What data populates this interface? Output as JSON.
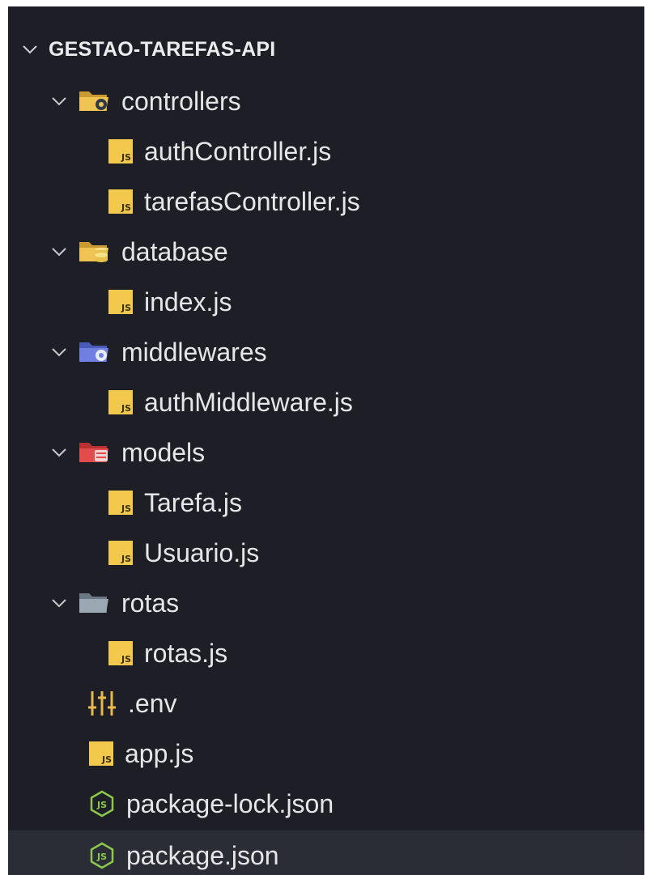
{
  "explorer": {
    "root_label": "GESTAO-TAREFAS-API",
    "js_badge": "JS",
    "items": [
      {
        "label": "controllers",
        "type": "folder",
        "icon": "folder-controllers-icon",
        "color": "#e8b84a"
      },
      {
        "label": "authController.js",
        "type": "js-file"
      },
      {
        "label": "tarefasController.js",
        "type": "js-file"
      },
      {
        "label": "database",
        "type": "folder",
        "icon": "folder-database-icon",
        "color": "#e8b84a"
      },
      {
        "label": "index.js",
        "type": "js-file"
      },
      {
        "label": "middlewares",
        "type": "folder",
        "icon": "folder-middleware-icon",
        "color": "#6b7bd6"
      },
      {
        "label": "authMiddleware.js",
        "type": "js-file"
      },
      {
        "label": "models",
        "type": "folder",
        "icon": "folder-models-icon",
        "color": "#e24c4c"
      },
      {
        "label": "Tarefa.js",
        "type": "js-file"
      },
      {
        "label": "Usuario.js",
        "type": "js-file"
      },
      {
        "label": "rotas",
        "type": "folder",
        "icon": "folder-icon",
        "color": "#8a9aa8"
      },
      {
        "label": "rotas.js",
        "type": "js-file"
      },
      {
        "label": ".env",
        "type": "env-file",
        "icon": "env-settings-icon"
      },
      {
        "label": "app.js",
        "type": "js-file"
      },
      {
        "label": "package-lock.json",
        "type": "node-file",
        "icon": "nodejs-icon"
      },
      {
        "label": "package.json",
        "type": "node-file",
        "icon": "nodejs-icon",
        "selected": true
      }
    ]
  },
  "colors": {
    "background": "#1e1f26",
    "selected_row": "#2b2d36",
    "js_icon": "#f2c94c",
    "node_icon": "#8cc84b",
    "env_icon": "#e8b84a"
  }
}
